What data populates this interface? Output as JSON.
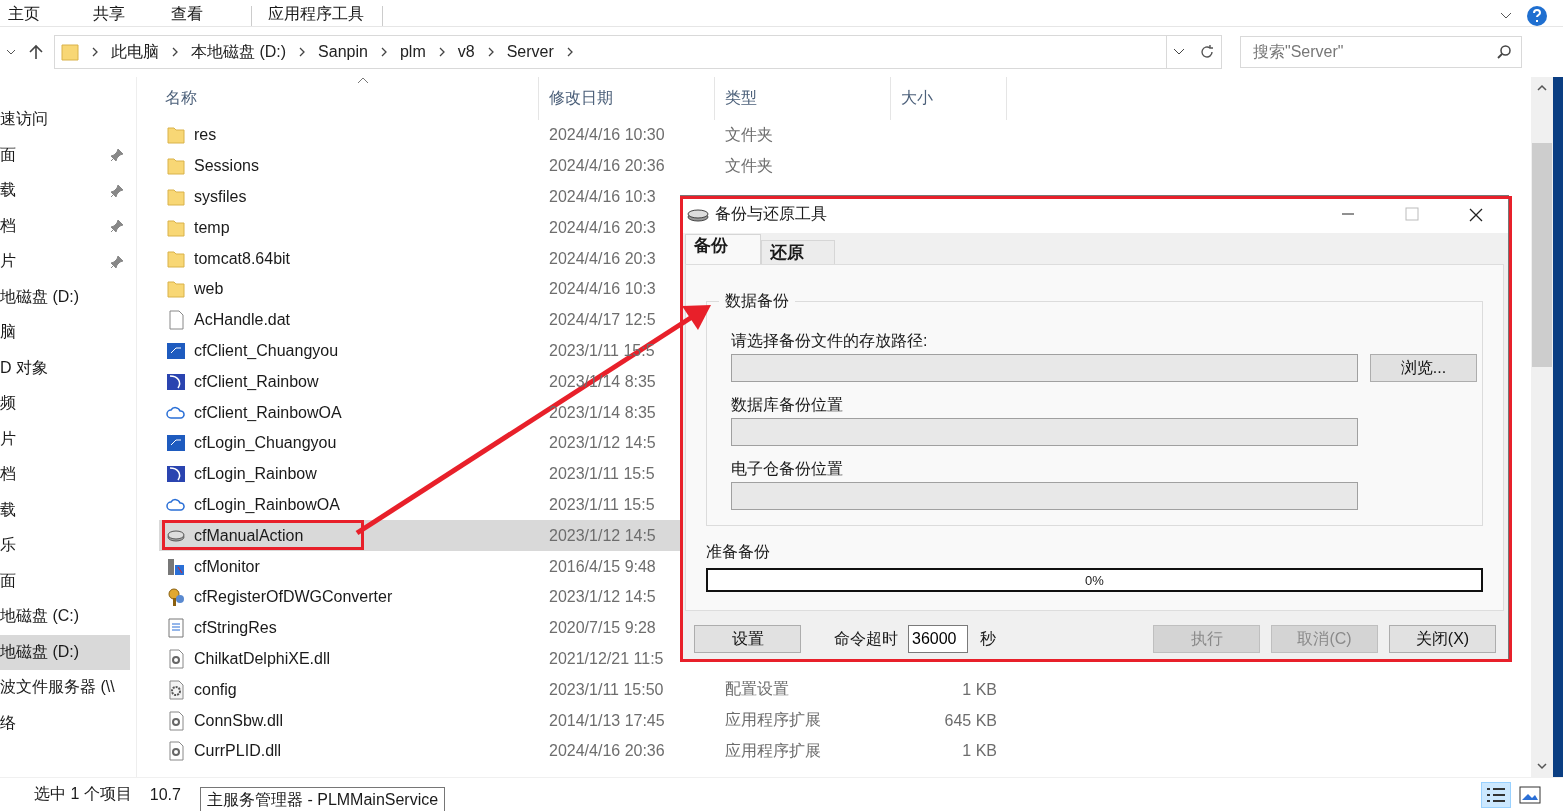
{
  "ribbon": {
    "tabs": [
      {
        "label": "主页",
        "kind": "normal"
      },
      {
        "label": "共享",
        "kind": "normal"
      },
      {
        "label": "查看",
        "kind": "normal"
      },
      {
        "label": "应用程序工具",
        "kind": "contextual"
      }
    ]
  },
  "address_bar": {
    "path": [
      "此电脑",
      "本地磁盘 (D:)",
      "Sanpin",
      "plm",
      "v8",
      "Server"
    ]
  },
  "search": {
    "placeholder": "搜索\"Server\""
  },
  "sidebar": {
    "items": [
      {
        "label": "速访问",
        "pinned": false,
        "selected": false
      },
      {
        "label": "面",
        "pinned": true,
        "selected": false
      },
      {
        "label": "载",
        "pinned": true,
        "selected": false
      },
      {
        "label": "档",
        "pinned": true,
        "selected": false
      },
      {
        "label": "片",
        "pinned": true,
        "selected": false
      },
      {
        "label": "地磁盘 (D:)",
        "pinned": false,
        "selected": false
      },
      {
        "label": "脑",
        "pinned": false,
        "selected": false
      },
      {
        "label": "D 对象",
        "pinned": false,
        "selected": false
      },
      {
        "label": "频",
        "pinned": false,
        "selected": false
      },
      {
        "label": "片",
        "pinned": false,
        "selected": false
      },
      {
        "label": "档",
        "pinned": false,
        "selected": false
      },
      {
        "label": "载",
        "pinned": false,
        "selected": false
      },
      {
        "label": "乐",
        "pinned": false,
        "selected": false
      },
      {
        "label": "面",
        "pinned": false,
        "selected": false
      },
      {
        "label": "地磁盘 (C:)",
        "pinned": false,
        "selected": false
      },
      {
        "label": "地磁盘 (D:)",
        "pinned": false,
        "selected": true
      },
      {
        "label": "波文件服务器 (\\\\",
        "pinned": false,
        "selected": false
      },
      {
        "label": "络",
        "pinned": false,
        "selected": false
      }
    ]
  },
  "file_list": {
    "columns": [
      "名称",
      "修改日期",
      "类型",
      "大小"
    ],
    "rows": [
      {
        "kind": "folder",
        "name": "res",
        "modified": "2024/4/16 10:30",
        "type": "文件夹",
        "selected": false
      },
      {
        "kind": "folder",
        "name": "Sessions",
        "modified": "2024/4/16 20:36",
        "type": "文件夹",
        "selected": false
      },
      {
        "kind": "folder",
        "name": "sysfiles",
        "modified": "2024/4/16 10:3",
        "selected": false
      },
      {
        "kind": "folder",
        "name": "temp",
        "modified": "2024/4/16 20:3",
        "selected": false
      },
      {
        "kind": "folder",
        "name": "tomcat8.64bit",
        "modified": "2024/4/16 20:3",
        "selected": false
      },
      {
        "kind": "folder",
        "name": "web",
        "modified": "2024/4/16 10:3",
        "selected": false
      },
      {
        "kind": "file",
        "name": "AcHandle.dat",
        "modified": "2024/4/17 12:5",
        "selected": false
      },
      {
        "kind": "app",
        "name": "cfClient_Chuangyou",
        "modified": "2023/1/11 15:5",
        "selected": false
      },
      {
        "kind": "swirl",
        "name": "cfClient_Rainbow",
        "modified": "2023/1/14 8:35",
        "selected": false
      },
      {
        "kind": "cloud",
        "name": "cfClient_RainbowOA",
        "modified": "2023/1/14 8:35",
        "selected": false
      },
      {
        "kind": "app",
        "name": "cfLogin_Chuangyou",
        "modified": "2023/1/12 14:5",
        "selected": false
      },
      {
        "kind": "swirl",
        "name": "cfLogin_Rainbow",
        "modified": "2023/1/11 15:5",
        "selected": false
      },
      {
        "kind": "cloud",
        "name": "cfLogin_RainbowOA",
        "modified": "2023/1/11 15:5",
        "selected": false
      },
      {
        "kind": "disk",
        "name": "cfManualAction",
        "modified": "2023/1/12 14:5",
        "selected": true
      },
      {
        "kind": "monitor",
        "name": "cfMonitor",
        "modified": "2016/4/15 9:48",
        "selected": false
      },
      {
        "kind": "keys",
        "name": "cfRegisterOfDWGConverter",
        "modified": "2023/1/12 14:5",
        "selected": false
      },
      {
        "kind": "text",
        "name": "cfStringRes",
        "modified": "2020/7/15 9:28",
        "selected": false
      },
      {
        "kind": "dll",
        "name": "ChilkatDelphiXE.dll",
        "modified": "2021/12/21 11:5",
        "selected": false
      },
      {
        "kind": "config",
        "name": "config",
        "modified": "2023/1/11 15:50",
        "type": "配置设置",
        "size": "1 KB",
        "selected": false
      },
      {
        "kind": "dll",
        "name": "ConnSbw.dll",
        "modified": "2014/1/13 17:45",
        "type": "应用程序扩展",
        "size": "645 KB",
        "selected": false
      },
      {
        "kind": "dll",
        "name": "CurrPLID.dll",
        "modified": "2024/4/16 20:36",
        "type": "应用程序扩展",
        "size": "1 KB",
        "selected": false
      }
    ]
  },
  "status_bar": {
    "selection": "选中 1 个项目",
    "size": "10.7"
  },
  "tooltip": "主服务管理器 - PLMMainService",
  "dialog": {
    "title": "备份与还原工具",
    "tabs": [
      {
        "label": "备份",
        "selected": true
      },
      {
        "label": "还原",
        "selected": false
      }
    ],
    "group": {
      "title": "数据备份",
      "fields": [
        {
          "label": "请选择备份文件的存放路径:",
          "browse": "浏览..."
        },
        {
          "label": "数据库备份位置"
        },
        {
          "label": "电子仓备份位置"
        }
      ]
    },
    "progress": {
      "label": "准备备份",
      "level": 0,
      "reading": "0%"
    },
    "footer": {
      "settings": "设置",
      "timeout_label": "命令超时",
      "timeout_value": "36000",
      "unit": "秒",
      "buttons": [
        {
          "label": "执行",
          "disabled": true
        },
        {
          "label": "取消(C)",
          "disabled": true
        },
        {
          "label": "关闭(X)",
          "disabled": false
        }
      ]
    }
  }
}
